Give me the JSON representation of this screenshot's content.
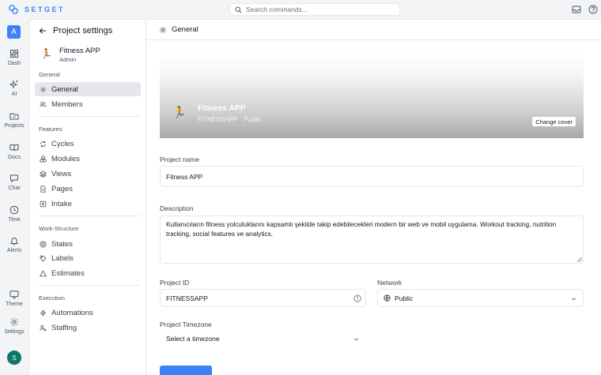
{
  "app": {
    "name": "SETGET",
    "accent": "#3b82f6"
  },
  "search": {
    "placeholder": "Search commands..."
  },
  "rail": {
    "workspace_initial": "A",
    "items": [
      {
        "label": "Dash",
        "icon": "dashboard-icon"
      },
      {
        "label": "AI",
        "icon": "sparkles-icon"
      },
      {
        "label": "Projects",
        "icon": "folder-icon"
      },
      {
        "label": "Docs",
        "icon": "book-icon"
      },
      {
        "label": "Chat",
        "icon": "chat-icon"
      },
      {
        "label": "Time",
        "icon": "clock-icon"
      },
      {
        "label": "Alerts",
        "icon": "bell-icon"
      },
      {
        "label": "Theme",
        "icon": "monitor-icon"
      },
      {
        "label": "Settings",
        "icon": "gear-icon"
      }
    ],
    "user_initial": "S"
  },
  "sidebar": {
    "title": "Project settings",
    "project": {
      "emoji": "🏃",
      "name": "Fitness APP",
      "role": "Admin"
    },
    "sections": {
      "general": "General",
      "features": "Features",
      "work_structure": "Work-Structure",
      "execution": "Execution"
    },
    "items": {
      "general": "General",
      "members": "Members",
      "cycles": "Cycles",
      "modules": "Modules",
      "views": "Views",
      "pages": "Pages",
      "intake": "Intake",
      "states": "States",
      "labels": "Labels",
      "estimates": "Estimates",
      "automations": "Automations",
      "staffing": "Staffing"
    }
  },
  "main": {
    "header": "General",
    "cover": {
      "emoji": "🏃",
      "name": "Fitness APP",
      "identifier": "FITNESSAPP",
      "visibility": "Public",
      "change_cover": "Change cover"
    },
    "project_name": {
      "label": "Project name",
      "value": "Fitness APP"
    },
    "description": {
      "label": "Description",
      "value": "Kullanıcıların fitness yolculuklarını kapsamlı şekilde takip edebilecekleri modern bir web ve mobil uygulama. Workout tracking, nutrition tracking, social features ve analytics."
    },
    "project_id": {
      "label": "Project ID",
      "value": "FITNESSAPP"
    },
    "network": {
      "label": "Network",
      "value": "Public"
    },
    "timezone": {
      "label": "Project Timezone",
      "value": "Select a timezone"
    }
  }
}
